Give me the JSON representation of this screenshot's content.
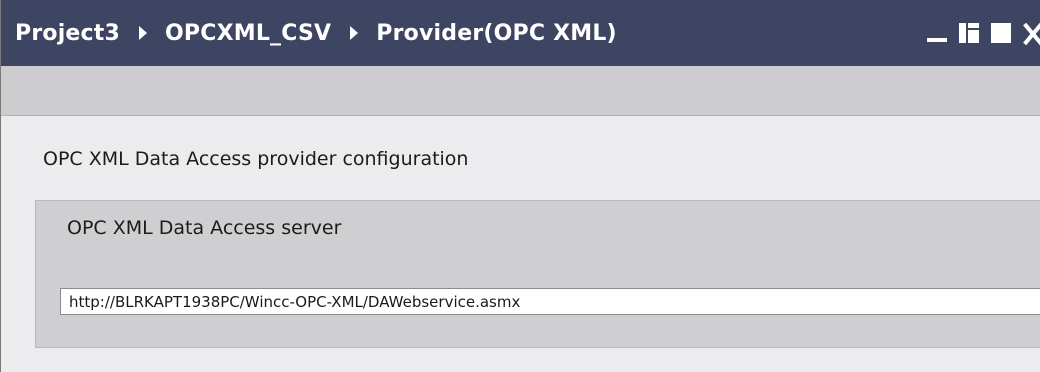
{
  "breadcrumb": {
    "items": [
      {
        "label": "Project3"
      },
      {
        "label": "OPCXML_CSV"
      },
      {
        "label": "Provider(OPC XML)"
      }
    ]
  },
  "window_controls": [
    "minimize-icon",
    "float-icon",
    "maximize-icon",
    "close-icon"
  ],
  "main": {
    "heading": "OPC XML Data Access provider configuration",
    "server_group": {
      "title": "OPC XML Data Access server",
      "url_value": "http://BLRKAPT1938PC/Wincc-OPC-XML/DAWebservice.asmx"
    }
  },
  "colors": {
    "titlebar": "#3e4563",
    "toolbar": "#cdcdd0",
    "background": "#ececee",
    "group_background": "#cfcfd2"
  }
}
